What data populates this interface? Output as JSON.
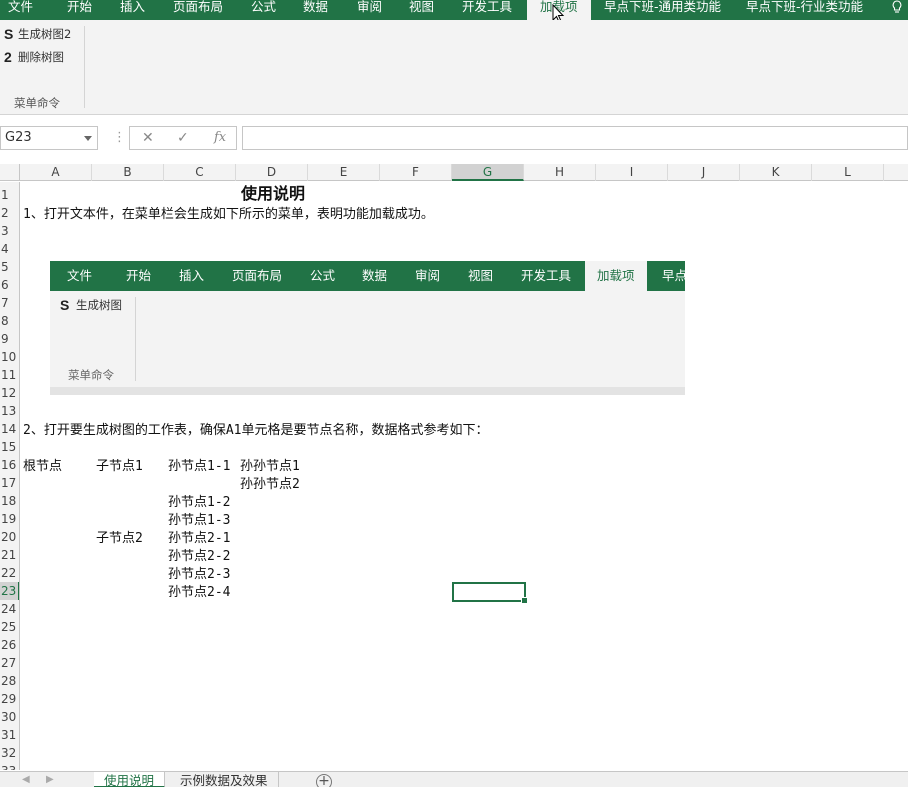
{
  "ribbon": {
    "tabs": [
      "文件",
      "开始",
      "插入",
      "页面布局",
      "公式",
      "数据",
      "审阅",
      "视图",
      "开发工具",
      "加载项",
      "早点下班-通用类功能",
      "早点下班-行业类功能"
    ],
    "active_tab": "加载项",
    "commands": [
      {
        "glyph": "S",
        "label": "生成树图2"
      },
      {
        "glyph": "2",
        "label": "删除树图"
      }
    ],
    "group_label": "菜单命令",
    "accent_color": "#217346"
  },
  "formula_bar": {
    "name_box": "G23",
    "cancel_icon": "✕",
    "enter_icon": "✓",
    "fx_label": "fx",
    "value": ""
  },
  "columns": [
    "A",
    "B",
    "C",
    "D",
    "E",
    "F",
    "G",
    "H",
    "I",
    "J",
    "K",
    "L"
  ],
  "selected_column": "G",
  "rows": [
    "1",
    "2",
    "3",
    "4",
    "5",
    "6",
    "7",
    "8",
    "9",
    "10",
    "11",
    "12",
    "13",
    "14",
    "15",
    "16",
    "17",
    "18",
    "19",
    "20",
    "21",
    "22",
    "23",
    "24",
    "25",
    "26",
    "27",
    "28",
    "29",
    "30",
    "31",
    "32",
    "33"
  ],
  "selected_row": "23",
  "cells": {
    "title": "使用说明",
    "line1": "1、打开文本件，在菜单栏会生成如下所示的菜单，表明功能加载成功。",
    "line2": "2、打开要生成树图的工作表，确保A1单元格是要节点名称，数据格式参考如下：",
    "root": "根节点",
    "child1": "子节点1",
    "child2": "子节点2",
    "gc11": "孙节点1-1",
    "ggc1": "孙孙节点1",
    "ggc2": "孙孙节点2",
    "gc12": "孙节点1-2",
    "gc13": "孙节点1-3",
    "gc21": "孙节点2-1",
    "gc22": "孙节点2-2",
    "gc23": "孙节点2-3",
    "gc24": "孙节点2-4"
  },
  "picture": {
    "tabs": [
      "文件",
      "开始",
      "插入",
      "页面布局",
      "公式",
      "数据",
      "审阅",
      "视图",
      "开发工具",
      "加载项",
      "早点"
    ],
    "active_tab": "加载项",
    "command": {
      "glyph": "S",
      "label": "生成树图"
    },
    "group_label": "菜单命令"
  },
  "sheet_tabs": [
    "使用说明",
    "示例数据及效果"
  ],
  "active_sheet": "使用说明",
  "add_sheet": "+"
}
